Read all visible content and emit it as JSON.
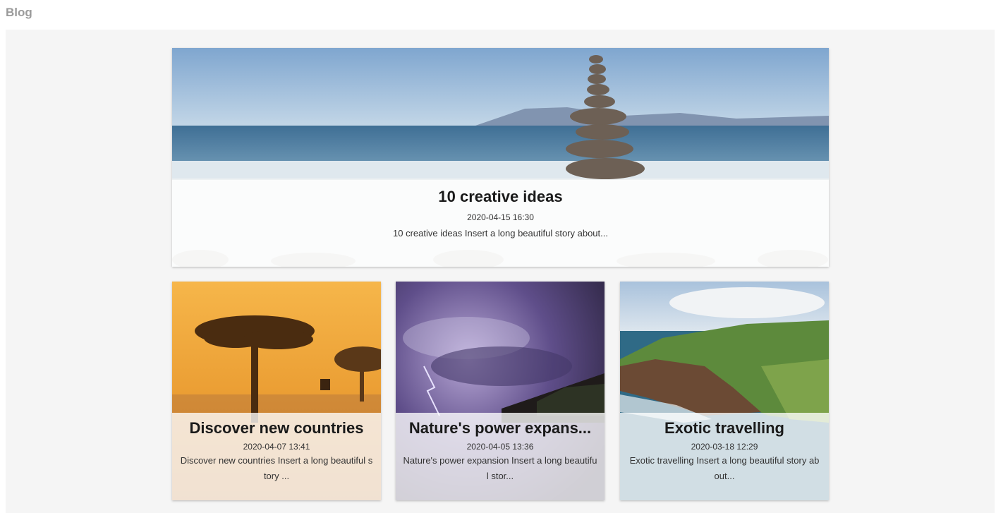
{
  "header": {
    "title": "Blog"
  },
  "featured": {
    "title": "10 creative ideas",
    "date": "2020-04-15 16:30",
    "excerpt": "10 creative ideas   Insert a long beautiful story about...",
    "image": "stacked-stones-beach-image"
  },
  "posts": [
    {
      "title": "Discover new countries",
      "date": "2020-04-07 13:41",
      "excerpt": "Discover new countries   Insert a long beautiful story ...",
      "image": "savanna-tree-sunset-image"
    },
    {
      "title": "Nature's power expans...",
      "date": "2020-04-05 13:36",
      "excerpt": "Nature's power expansion   Insert a long beautiful stor...",
      "image": "lightning-storm-image"
    },
    {
      "title": "Exotic travelling",
      "date": "2020-03-18 12:29",
      "excerpt": "Exotic travelling   Insert a long beautiful story about...",
      "image": "coastal-cliffs-image"
    }
  ],
  "colors": {
    "background": "#f5f5f5",
    "overlay": "rgba(255,255,255,0.78)",
    "header_text": "#9a9a9a"
  }
}
